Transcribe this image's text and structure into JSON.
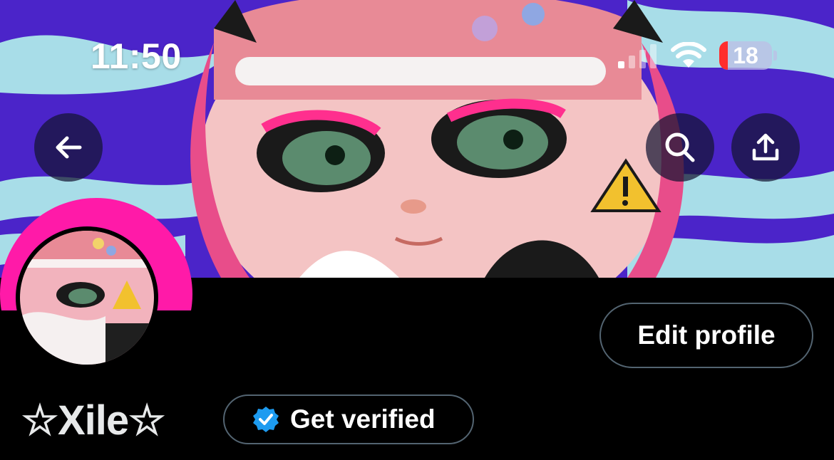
{
  "status_bar": {
    "time": "11:50",
    "battery": "18",
    "icons": [
      "cellular-signal-icon",
      "wifi-icon",
      "battery-icon"
    ]
  },
  "header": {
    "back_icon": "arrow-left-icon",
    "search_icon": "search-icon",
    "share_icon": "share-upload-icon"
  },
  "profile": {
    "display_name": "☆Xile☆",
    "edit_button_label": "Edit profile",
    "verify_button_label": "Get verified",
    "verify_icon": "verified-badge-icon"
  },
  "colors": {
    "banner_purple": "#4b24c9",
    "banner_wave": "#a8dde8",
    "avatar_ring": "#ff1aa8",
    "verified_blue": "#1d9bf0",
    "background": "#000000",
    "button_border": "#536471"
  }
}
